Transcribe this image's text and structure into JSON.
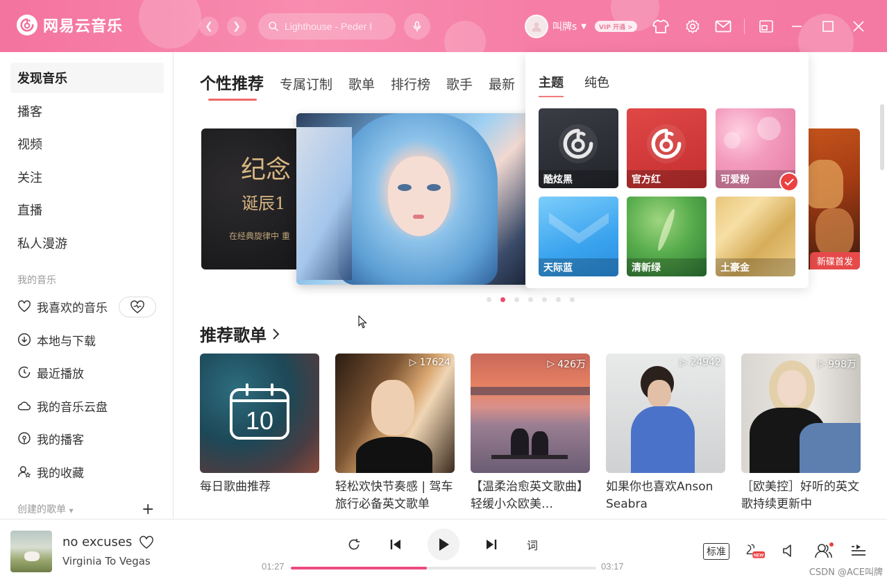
{
  "app": {
    "logo_text": "网易云音乐"
  },
  "search": {
    "placeholder": "Lighthouse - Peder I"
  },
  "user": {
    "name": "叫牌s",
    "vip_badge": "VIP 开通 >"
  },
  "sidebar": {
    "items": [
      {
        "label": "发现音乐",
        "active": true
      },
      {
        "label": "播客"
      },
      {
        "label": "视频"
      },
      {
        "label": "关注"
      },
      {
        "label": "直播"
      },
      {
        "label": "私人漫游"
      }
    ],
    "my_music_title": "我的音乐",
    "my_music": [
      {
        "label": "我喜欢的音乐",
        "icon": "heart-icon"
      },
      {
        "label": "本地与下载",
        "icon": "download-icon"
      },
      {
        "label": "最近播放",
        "icon": "clock-icon"
      },
      {
        "label": "我的音乐云盘",
        "icon": "cloud-icon"
      },
      {
        "label": "我的播客",
        "icon": "podcast-icon"
      },
      {
        "label": "我的收藏",
        "icon": "star-user-icon"
      }
    ],
    "created_title": "创建的歌单"
  },
  "main": {
    "tabs": [
      "个性推荐",
      "专属订制",
      "歌单",
      "排行榜",
      "歌手",
      "最新"
    ],
    "banner_left": {
      "line1": "纪念",
      "line2": "诞辰1",
      "line3": "在经典旋律中 重"
    },
    "banner_right_tag": "新碟首发",
    "banner_dots": 7,
    "banner_active_dot": 1,
    "section_title": "推荐歌单",
    "daily": {
      "day": "10"
    },
    "playlists": [
      {
        "title": "每日歌曲推荐",
        "plays": ""
      },
      {
        "title": "轻松欢快节奏感 | 驾车旅行必备英文歌单",
        "plays": "17624"
      },
      {
        "title": "【温柔治愈英文歌曲】轻缓小众欧美…",
        "plays": "426万"
      },
      {
        "title": "如果你也喜欢Anson Seabra",
        "plays": "24942"
      },
      {
        "title": "［欧美控］好听的英文歌持续更新中",
        "plays": "998万"
      }
    ]
  },
  "theme_popup": {
    "tabs": [
      "主题",
      "纯色"
    ],
    "themes": [
      {
        "label": "酷炫黑"
      },
      {
        "label": "官方红"
      },
      {
        "label": "可爱粉",
        "selected": true
      },
      {
        "label": "天际蓝"
      },
      {
        "label": "清新绿"
      },
      {
        "label": "土豪金"
      }
    ]
  },
  "player": {
    "song": "no excuses",
    "artist": "Virginia To Vegas",
    "current": "01:27",
    "total": "03:17",
    "progress": 0.446,
    "lyrics_label": "词",
    "quality_label": "标准"
  },
  "watermark": "CSDN @ACE叫牌",
  "colors": {
    "accent": "#ec4141",
    "titlebar": "#f67ea6",
    "progress": "#ec4a82"
  }
}
